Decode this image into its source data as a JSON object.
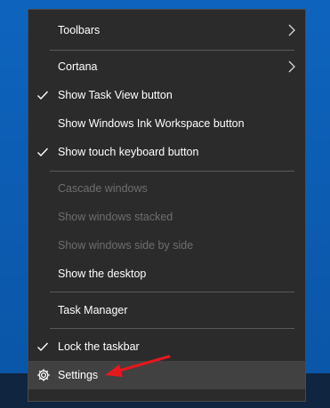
{
  "menu": {
    "items": [
      {
        "label": "Toolbars",
        "submenu": true
      },
      {
        "label": "Cortana",
        "submenu": true
      },
      {
        "label": "Show Task View button",
        "checked": true
      },
      {
        "label": "Show Windows Ink Workspace button",
        "checked": false
      },
      {
        "label": "Show touch keyboard button",
        "checked": true
      },
      {
        "label": "Cascade windows",
        "disabled": true
      },
      {
        "label": "Show windows stacked",
        "disabled": true
      },
      {
        "label": "Show windows side by side",
        "disabled": true
      },
      {
        "label": "Show the desktop"
      },
      {
        "label": "Task Manager"
      },
      {
        "label": "Lock the taskbar",
        "checked": true
      },
      {
        "label": "Settings",
        "icon": "gear-icon",
        "hovered": true
      }
    ]
  },
  "colors": {
    "menu_bg": "#2b2b2b",
    "hover_bg": "#414141",
    "disabled_text": "#6e6e6e",
    "arrow": "#e8161d",
    "desktop": "#0c5db0"
  }
}
